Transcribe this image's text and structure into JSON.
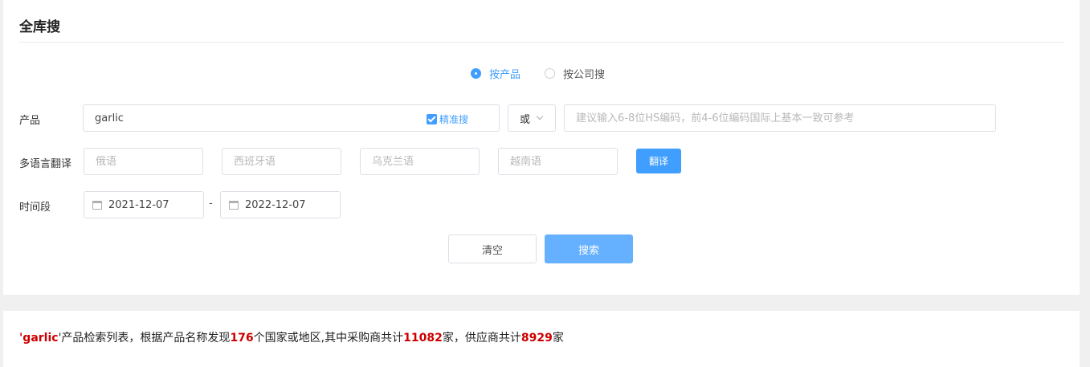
{
  "title": "全库搜",
  "search_mode": {
    "options": [
      {
        "label": "按产品",
        "checked": true
      },
      {
        "label": "按公司搜",
        "checked": false
      }
    ]
  },
  "product_row": {
    "label": "产品",
    "value": "garlic",
    "precise_label": "精准搜",
    "precise_checked": true,
    "operator": "或",
    "hs_placeholder": "建议输入6-8位HS编码，前4-6位编码国际上基本一致可参考"
  },
  "translate_row": {
    "label": "多语言翻译",
    "placeholders": [
      "俄语",
      "西班牙语",
      "乌克兰语",
      "越南语"
    ],
    "button": "翻译"
  },
  "date_row": {
    "label": "时间段",
    "start": "2021-12-07",
    "separator": "-",
    "end": "2022-12-07"
  },
  "actions": {
    "clear": "清空",
    "search": "搜索"
  },
  "result_summary": {
    "quote_open": "'",
    "keyword": "garlic",
    "text1": "'产品检索列表，根据产品名称发现",
    "countries": "176",
    "text2": "个国家或地区,其中采购商共计",
    "buyers": "11082",
    "text3": "家，供应商共计",
    "suppliers": "8929",
    "text4": "家"
  },
  "colors": {
    "accent": "#409eff",
    "search_button": "#66b1ff",
    "highlight": "#cc0000"
  }
}
